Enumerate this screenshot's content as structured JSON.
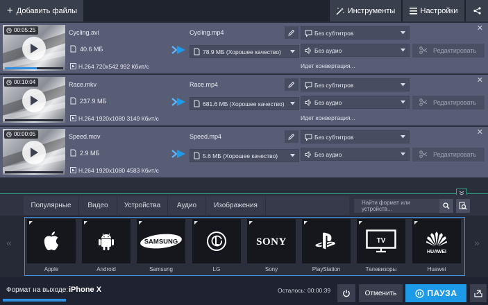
{
  "toolbar": {
    "add_files_label": "Добавить файлы",
    "tools_label": "Инструменты",
    "settings_label": "Настройки"
  },
  "files": [
    {
      "duration": "00:05:25",
      "progress": 0.55,
      "source_name": "Cycling.avi",
      "source_size": "40.6 МБ",
      "source_meta": "H.264 720x542 992 Кбит/с",
      "output_name": "Cycling.mp4",
      "output_quality": "78.9 МБ (Хорошее качество)",
      "subtitles": "Без субтитров",
      "audio": "Без аудио",
      "status": "Идет конвертация...",
      "edit_label": "Редактировать"
    },
    {
      "duration": "00:10:04",
      "progress": 0,
      "source_name": "Race.mkv",
      "source_size": "237.9 МБ",
      "source_meta": "H.264 1920x1080 3149 Кбит/с",
      "output_name": "Race.mp4",
      "output_quality": "681.6 МБ (Хорошее качество)",
      "subtitles": "Без субтитров",
      "audio": "Без аудио",
      "status": "Идет конвертация...",
      "edit_label": "Редактировать"
    },
    {
      "duration": "00:00:05",
      "progress": 0,
      "source_name": "Speed.mov",
      "source_size": "2.9 МБ",
      "source_meta": "H.264 1920x1080 4583 Кбит/с",
      "output_name": "Speed.mp4",
      "output_quality": "5.6 МБ (Хорошее качество)",
      "subtitles": "Без субтитров",
      "audio": "Без аудио",
      "status": "",
      "edit_label": "Редактировать"
    }
  ],
  "format_tabs": [
    "Популярные",
    "Видео",
    "Устройства",
    "Аудио",
    "Изображения"
  ],
  "search_placeholder": "Найти формат или устройств...",
  "devices": [
    {
      "label": "Apple",
      "icon": "apple-logo-icon"
    },
    {
      "label": "Android",
      "icon": "android-robot-icon"
    },
    {
      "label": "Samsung",
      "icon": "samsung-logo-icon",
      "logo_text": "SAMSUNG"
    },
    {
      "label": "LG",
      "icon": "lg-logo-icon"
    },
    {
      "label": "Sony",
      "icon": "sony-logo-icon",
      "logo_text": "SONY"
    },
    {
      "label": "PlayStation",
      "icon": "playstation-logo-icon"
    },
    {
      "label": "Телевизоры",
      "icon": "tv-icon",
      "logo_text": "TV"
    },
    {
      "label": "Huawei",
      "icon": "huawei-logo-icon",
      "logo_text": "HUAWEI"
    }
  ],
  "bottom": {
    "output_format_label": "Формат на выходе:",
    "output_format_value": "iPhone X",
    "remaining_label": "Осталось:",
    "remaining_value": "00:00:39",
    "cancel_label": "Отменить",
    "pause_label": "ПАУЗА",
    "overall_progress": 0.13
  },
  "colors": {
    "accent": "#1e9be8",
    "row_bg": "#575d75",
    "app_bg": "#2a2e3b",
    "divider": "#35a88a"
  }
}
